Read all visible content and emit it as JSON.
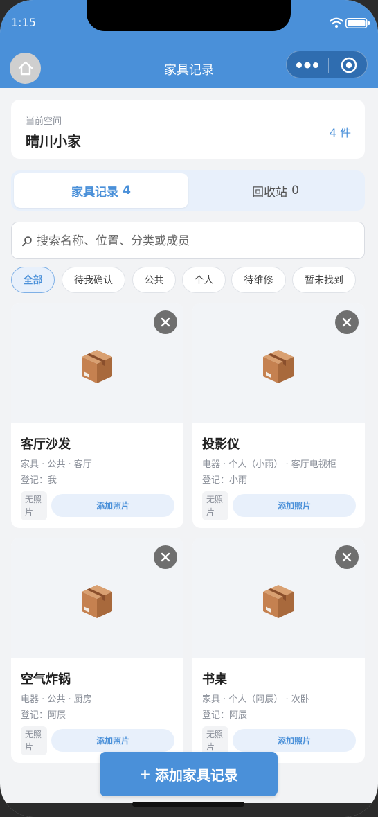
{
  "status_bar": {
    "time": "1:15",
    "wifi_icon": "wifi-icon",
    "battery_icon": "battery-icon"
  },
  "nav": {
    "title": "家具记录",
    "home_icon": "home-icon",
    "more_icon": "more-dots-icon",
    "close_icon": "target-icon",
    "accent": "#4a90d9"
  },
  "space": {
    "label": "当前空间",
    "name": "晴川小家",
    "count": "4 件"
  },
  "tabs": [
    {
      "label": "家具记录",
      "count": "4"
    },
    {
      "label": "回收站",
      "count": "0"
    }
  ],
  "search": {
    "placeholder": "搜索名称、位置、分类或成员"
  },
  "filters": [
    "全部",
    "待我确认",
    "公共",
    "个人",
    "待维修",
    "暂未找到"
  ],
  "items": [
    {
      "name": "客厅沙发",
      "meta": "家具 · 公共 · 客厅",
      "owner": "登记：我",
      "no_photo": "无照片",
      "add_photo": "添加照片"
    },
    {
      "name": "投影仪",
      "meta": "电器 · 个人（小雨） · 客厅电视柜",
      "owner": "登记：小雨",
      "no_photo": "无照片",
      "add_photo": "添加照片"
    },
    {
      "name": "空气炸锅",
      "meta": "电器 · 公共 · 厨房",
      "owner": "登记：阿辰",
      "no_photo": "无照片",
      "add_photo": "添加照片"
    },
    {
      "name": "书桌",
      "meta": "家具 · 个人（阿辰） · 次卧",
      "owner": "登记：阿辰",
      "no_photo": "无照片",
      "add_photo": "添加照片"
    }
  ],
  "fab": {
    "plus": "+",
    "label": "添加家具记录"
  }
}
